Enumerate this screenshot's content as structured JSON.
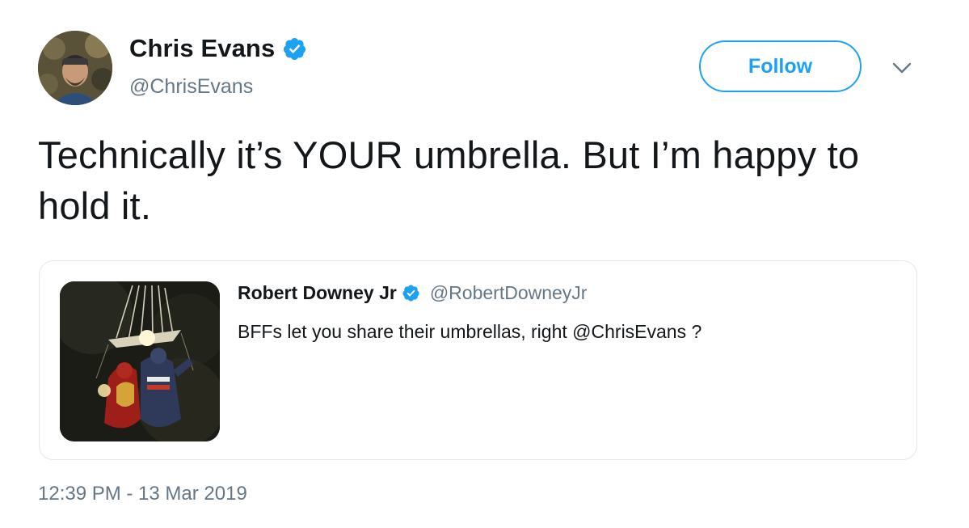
{
  "author": {
    "display_name": "Chris Evans",
    "handle": "@ChrisEvans",
    "verified": true
  },
  "follow_button": {
    "label": "Follow"
  },
  "more_menu": {
    "icon": "chevron-down-icon"
  },
  "tweet": {
    "text": "Technically it’s YOUR umbrella. But I’m happy to hold it.",
    "timestamp": "12:39 PM - 13 Mar 2019"
  },
  "quoted_tweet": {
    "display_name": "Robert Downey Jr",
    "handle": "@RobertDowneyJr",
    "verified": true,
    "text": "BFFs let you share their umbrellas, right @ChrisEvans ?"
  },
  "colors": {
    "accent": "#1da1f2",
    "text_primary": "#14171a",
    "text_secondary": "#657786",
    "border": "#e1e8ed"
  }
}
